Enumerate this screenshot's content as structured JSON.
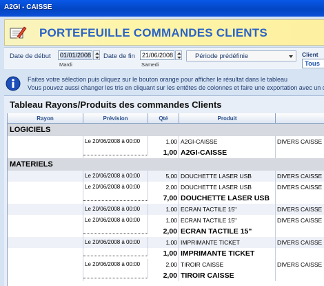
{
  "window": {
    "title": "A2GI - CAISSE"
  },
  "header": {
    "title": "PORTEFEUILLE COMMANDES CLIENTS",
    "icon": "pencil-paper-icon"
  },
  "filters": {
    "start_label": "Date de début",
    "start_value": "01/01/2008",
    "start_day": "Mardi",
    "end_label": "Date de fin",
    "end_value": "21/06/2008",
    "end_day": "Samedi",
    "period_value": "Période prédéfinie",
    "client_label": "Client",
    "client_value": "Tous"
  },
  "info": {
    "line1": "Faites votre sélection puis cliquez sur le bouton orange pour afficher le résultat dans le tableau",
    "line2": "Vous pouvez aussi changer les tris en cliquant sur les entêtes de colonnes et faire une exportation avec un clic"
  },
  "table": {
    "title": "Tableau Rayons/Produits des commandes Clients",
    "columns": [
      "Rayon",
      "Prévision",
      "Qté",
      "Produit",
      ""
    ],
    "rows": [
      {
        "type": "group",
        "name": "LOGICIELS"
      },
      {
        "type": "item",
        "prevision": "Le 20/06/2008 à 00:00",
        "qte": "1,00",
        "produit": "A2GI-CAISSE",
        "extra": "DIVERS CAISSE"
      },
      {
        "type": "total",
        "qte": "1,00",
        "produit": "A2GI-CAISSE"
      },
      {
        "type": "group",
        "name": "MATERIELS"
      },
      {
        "type": "item",
        "prevision": "Le 20/06/2008 à 00:00",
        "qte": "5,00",
        "produit": "DOUCHETTE LASER USB",
        "extra": "DIVERS CAISSE"
      },
      {
        "type": "item",
        "prevision": "Le 20/06/2008 à 00:00",
        "qte": "2,00",
        "produit": "DOUCHETTE LASER USB",
        "extra": "DIVERS CAISSE"
      },
      {
        "type": "total",
        "qte": "7,00",
        "produit": "DOUCHETTE LASER USB"
      },
      {
        "type": "item",
        "prevision": "Le 20/06/2008 à 00:00",
        "qte": "1,00",
        "produit": "ECRAN TACTILE 15\"",
        "extra": "DIVERS CAISSE"
      },
      {
        "type": "item",
        "prevision": "Le 20/06/2008 à 00:00",
        "qte": "1,00",
        "produit": "ECRAN TACTILE 15\"",
        "extra": "DIVERS CAISSE"
      },
      {
        "type": "total",
        "qte": "2,00",
        "produit": "ECRAN TACTILE 15\""
      },
      {
        "type": "item",
        "prevision": "Le 20/06/2008 à 00:00",
        "qte": "1,00",
        "produit": "IMPRIMANTE TICKET",
        "extra": "DIVERS CAISSE"
      },
      {
        "type": "total",
        "qte": "1,00",
        "produit": "IMPRIMANTE TICKET"
      },
      {
        "type": "item",
        "prevision": "Le 20/06/2008 à 00:00",
        "qte": "2,00",
        "produit": "TIROIR CAISSE",
        "extra": "DIVERS CAISSE"
      },
      {
        "type": "total",
        "qte": "2,00",
        "produit": "TIROIR CAISSE"
      }
    ]
  }
}
